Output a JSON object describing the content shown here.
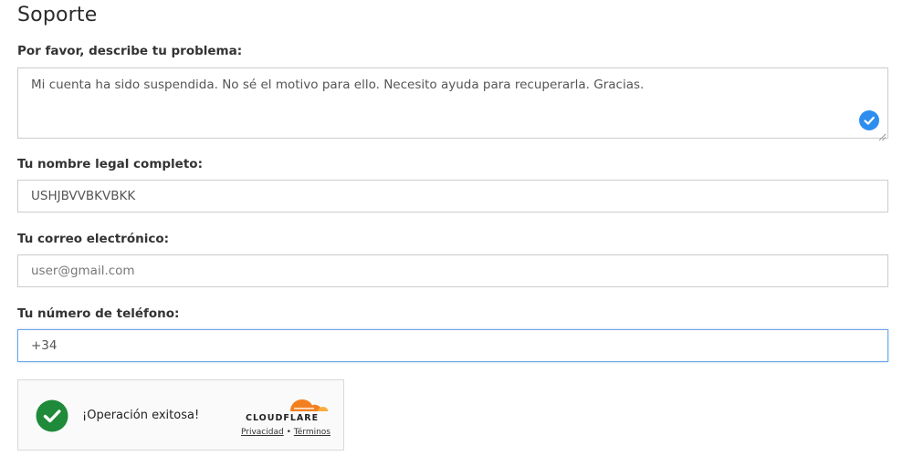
{
  "page": {
    "title": "Soporte"
  },
  "form": {
    "problem": {
      "label": "Por favor, describe tu problema:",
      "value": "Mi cuenta ha sido suspendida. No sé el motivo para ello. Necesito ayuda para recuperarla. Gracias."
    },
    "name": {
      "label": "Tu nombre legal completo:",
      "value": "USHJBVVBKVBKK"
    },
    "email": {
      "label": "Tu correo electrónico:",
      "placeholder": "user@gmail.com"
    },
    "phone": {
      "label": "Tu número de teléfono:",
      "value": "+34"
    }
  },
  "captcha": {
    "status": "¡Operación exitosa!",
    "brand": "CLOUDFLARE",
    "privacy_link": "Privacidad",
    "separator": "•",
    "terms_link": "Términos",
    "success_color": "#1e8a3a",
    "brand_color": "#f38020"
  },
  "icons": {
    "valid_check": "check-circle-icon",
    "success": "success-check-icon",
    "logo": "cloudflare-cloud-icon"
  }
}
